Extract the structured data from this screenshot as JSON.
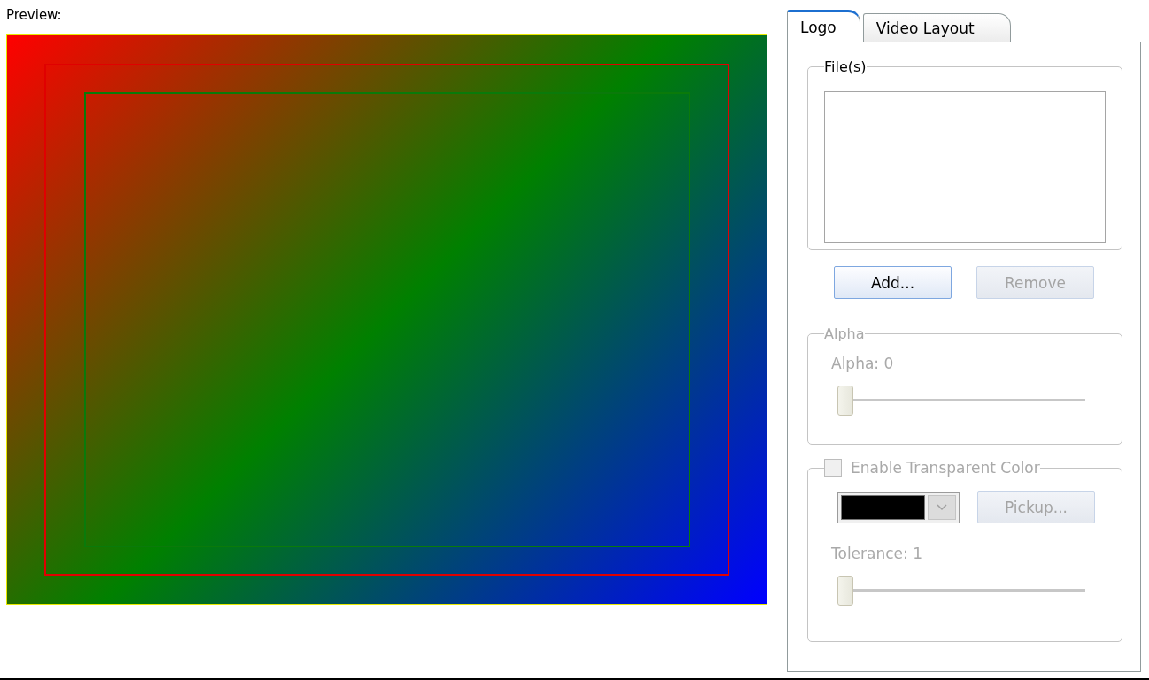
{
  "preview": {
    "label": "Preview:"
  },
  "tabs": [
    {
      "label": "Logo",
      "selected": true
    },
    {
      "label": "Video Layout",
      "selected": false
    }
  ],
  "files_group": {
    "title": "File(s)",
    "buttons": [
      {
        "label": "Add...",
        "disabled": false
      },
      {
        "label": "Remove",
        "disabled": true
      }
    ]
  },
  "alpha_group": {
    "title": "Alpha",
    "disabled": true,
    "slider_label": "Alpha: 0",
    "level": 0
  },
  "transparent_group": {
    "title": "Enable Transparent Color",
    "checked": false,
    "disabled": true,
    "color": "#000000",
    "pickup_button": {
      "label": "Pickup...",
      "disabled": true
    },
    "tolerance_label": "Tolerance: 1",
    "level": 0
  }
}
